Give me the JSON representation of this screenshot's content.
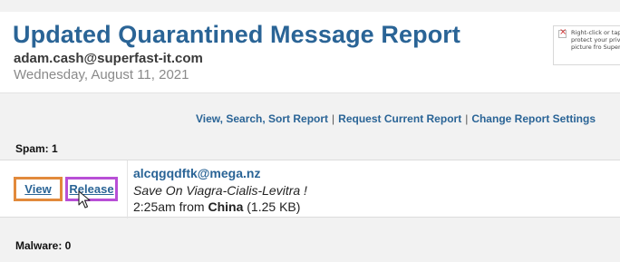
{
  "header": {
    "title": "Updated Quarantined Message Report",
    "email": "adam.cash@superfast-it.com",
    "date": "Wednesday, August 11, 2021",
    "broken_image_text": "Right-click or tap protect your priv of this picture fro Superfast IT"
  },
  "links": {
    "view_search_sort": "View, Search, Sort Report",
    "separator": "|",
    "request_current": "Request Current Report",
    "change_settings": "Change Report Settings"
  },
  "spam": {
    "label": "Spam: 1",
    "items": [
      {
        "view_label": "View",
        "release_label": "Release",
        "sender": "alcqgqdftk@mega.nz",
        "subject": "Save On Viagra-Cialis-Levitra !",
        "time_from": "2:25am from ",
        "country": "China",
        "size": " (1.25 KB)"
      }
    ]
  },
  "malware": {
    "label": "Malware: 0"
  },
  "colors": {
    "link_blue": "#2a6496",
    "view_highlight": "#e28a3c",
    "release_highlight": "#b84fd6"
  }
}
